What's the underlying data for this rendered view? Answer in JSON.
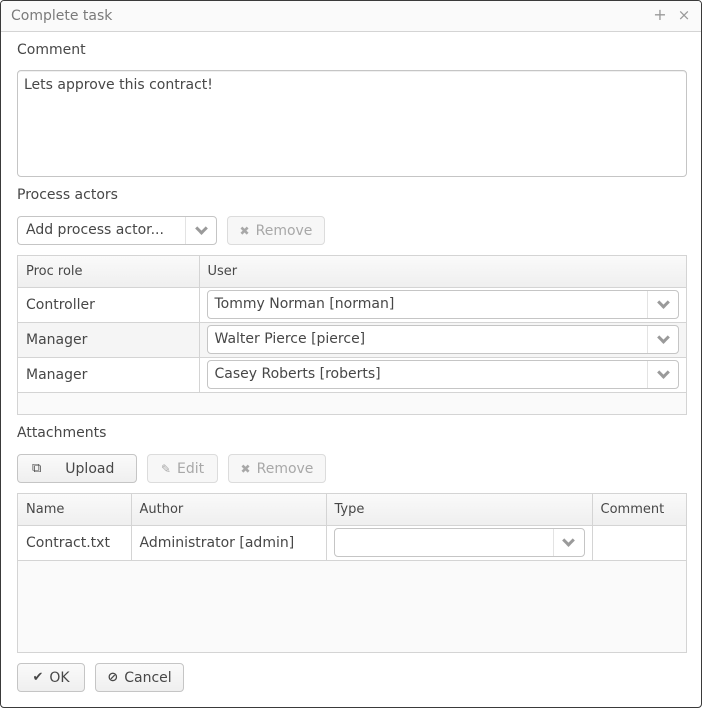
{
  "window": {
    "title": "Complete task",
    "maximize_icon": "+",
    "close_icon": "×"
  },
  "comment": {
    "label": "Comment",
    "value": "Lets approve this contract!"
  },
  "process_actors": {
    "label": "Process actors",
    "add_placeholder": "Add process actor...",
    "remove_label": "Remove",
    "columns": [
      "Proc role",
      "User"
    ],
    "rows": [
      {
        "role": "Controller",
        "user": "Tommy Norman [norman]"
      },
      {
        "role": "Manager",
        "user": "Walter Pierce [pierce]"
      },
      {
        "role": "Manager",
        "user": "Casey Roberts [roberts]"
      }
    ]
  },
  "attachments": {
    "label": "Attachments",
    "upload_label": "Upload",
    "edit_label": "Edit",
    "remove_label": "Remove",
    "columns": [
      "Name",
      "Author",
      "Type",
      "Comment"
    ],
    "rows": [
      {
        "name": "Contract.txt",
        "author": "Administrator [admin]",
        "type": "",
        "comment": ""
      }
    ]
  },
  "footer": {
    "ok_label": "OK",
    "cancel_label": "Cancel"
  }
}
